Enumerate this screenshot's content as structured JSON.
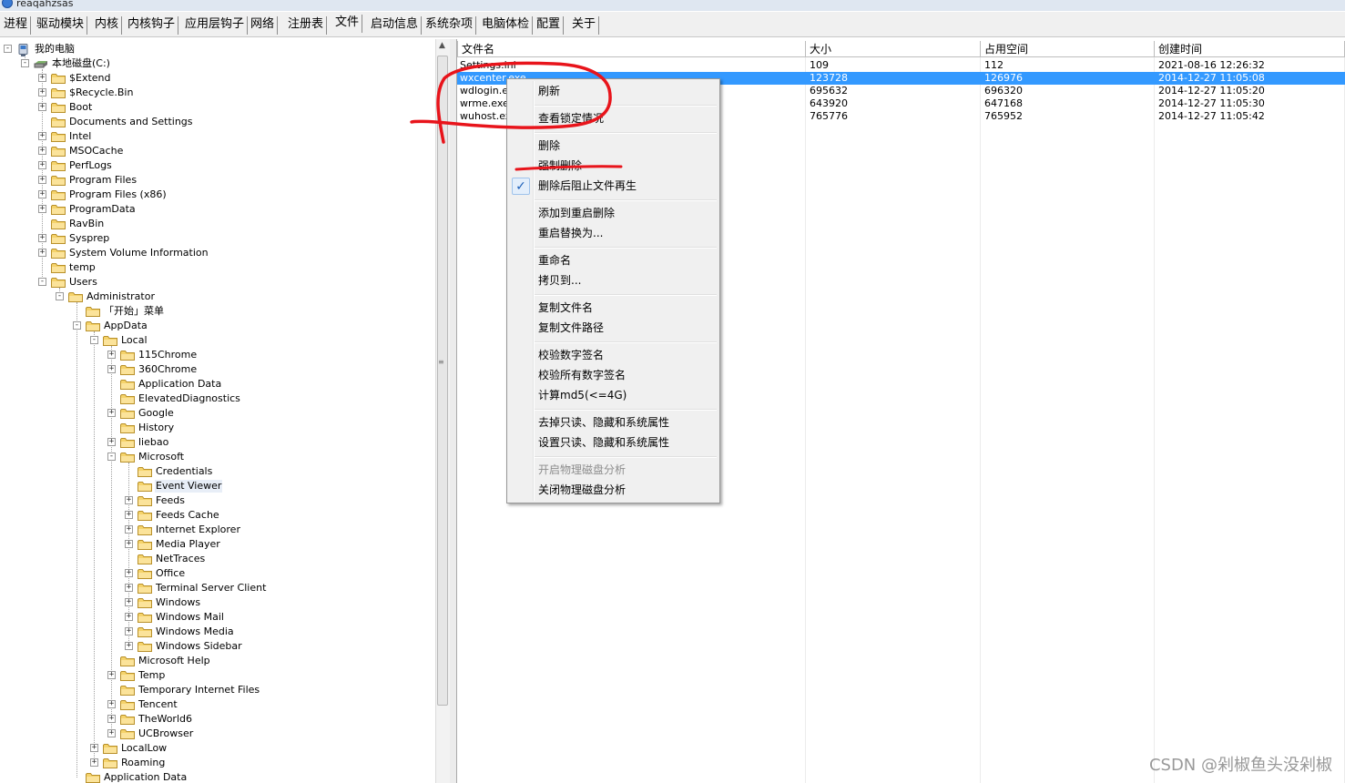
{
  "window": {
    "title": "reaqahzsas"
  },
  "tabs": [
    {
      "label": "进程",
      "active": false
    },
    {
      "label": "驱动模块",
      "active": false
    },
    {
      "label": "内核",
      "active": false
    },
    {
      "label": "内核钩子",
      "active": false
    },
    {
      "label": "应用层钩子",
      "active": false
    },
    {
      "label": "网络",
      "active": false
    },
    {
      "label": "注册表",
      "active": false
    },
    {
      "label": "文件",
      "active": true
    },
    {
      "label": "启动信息",
      "active": false
    },
    {
      "label": "系统杂项",
      "active": false
    },
    {
      "label": "电脑体检",
      "active": false
    },
    {
      "label": "配置",
      "active": false
    },
    {
      "label": "关于",
      "active": false
    }
  ],
  "tree": [
    {
      "label": "我的电脑",
      "level": 0,
      "expander": "-",
      "icon": "computer-icon"
    },
    {
      "label": "本地磁盘(C:)",
      "level": 1,
      "expander": "-",
      "icon": "drive-icon"
    },
    {
      "label": "$Extend",
      "level": 2,
      "expander": "+",
      "icon": "folder-icon"
    },
    {
      "label": "$Recycle.Bin",
      "level": 2,
      "expander": "+",
      "icon": "folder-icon"
    },
    {
      "label": "Boot",
      "level": 2,
      "expander": "+",
      "icon": "folder-icon"
    },
    {
      "label": "Documents and Settings",
      "level": 2,
      "expander": "",
      "icon": "folder-icon"
    },
    {
      "label": "Intel",
      "level": 2,
      "expander": "+",
      "icon": "folder-icon"
    },
    {
      "label": "MSOCache",
      "level": 2,
      "expander": "+",
      "icon": "folder-icon"
    },
    {
      "label": "PerfLogs",
      "level": 2,
      "expander": "+",
      "icon": "folder-icon"
    },
    {
      "label": "Program Files",
      "level": 2,
      "expander": "+",
      "icon": "folder-icon"
    },
    {
      "label": "Program Files (x86)",
      "level": 2,
      "expander": "+",
      "icon": "folder-icon"
    },
    {
      "label": "ProgramData",
      "level": 2,
      "expander": "+",
      "icon": "folder-icon"
    },
    {
      "label": "RavBin",
      "level": 2,
      "expander": "",
      "icon": "folder-icon"
    },
    {
      "label": "Sysprep",
      "level": 2,
      "expander": "+",
      "icon": "folder-icon"
    },
    {
      "label": "System Volume Information",
      "level": 2,
      "expander": "+",
      "icon": "folder-icon"
    },
    {
      "label": "temp",
      "level": 2,
      "expander": "",
      "icon": "folder-icon"
    },
    {
      "label": "Users",
      "level": 2,
      "expander": "-",
      "icon": "folder-icon"
    },
    {
      "label": "Administrator",
      "level": 3,
      "expander": "-",
      "icon": "folder-icon"
    },
    {
      "label": "「开始」菜单",
      "level": 4,
      "expander": "",
      "icon": "folder-icon"
    },
    {
      "label": "AppData",
      "level": 4,
      "expander": "-",
      "icon": "folder-icon"
    },
    {
      "label": "Local",
      "level": 5,
      "expander": "-",
      "icon": "folder-icon"
    },
    {
      "label": "115Chrome",
      "level": 6,
      "expander": "+",
      "icon": "folder-icon"
    },
    {
      "label": "360Chrome",
      "level": 6,
      "expander": "+",
      "icon": "folder-icon"
    },
    {
      "label": "Application Data",
      "level": 6,
      "expander": "",
      "icon": "folder-icon"
    },
    {
      "label": "ElevatedDiagnostics",
      "level": 6,
      "expander": "",
      "icon": "folder-icon"
    },
    {
      "label": "Google",
      "level": 6,
      "expander": "+",
      "icon": "folder-icon"
    },
    {
      "label": "History",
      "level": 6,
      "expander": "",
      "icon": "folder-icon"
    },
    {
      "label": "liebao",
      "level": 6,
      "expander": "+",
      "icon": "folder-icon"
    },
    {
      "label": "Microsoft",
      "level": 6,
      "expander": "-",
      "icon": "folder-icon"
    },
    {
      "label": "Credentials",
      "level": 7,
      "expander": "",
      "icon": "folder-icon"
    },
    {
      "label": "Event Viewer",
      "level": 7,
      "expander": "",
      "icon": "folder-icon",
      "highlight": true
    },
    {
      "label": "Feeds",
      "level": 7,
      "expander": "+",
      "icon": "folder-icon"
    },
    {
      "label": "Feeds Cache",
      "level": 7,
      "expander": "+",
      "icon": "folder-icon"
    },
    {
      "label": "Internet Explorer",
      "level": 7,
      "expander": "+",
      "icon": "folder-icon"
    },
    {
      "label": "Media Player",
      "level": 7,
      "expander": "+",
      "icon": "folder-icon"
    },
    {
      "label": "NetTraces",
      "level": 7,
      "expander": "",
      "icon": "folder-icon"
    },
    {
      "label": "Office",
      "level": 7,
      "expander": "+",
      "icon": "folder-icon"
    },
    {
      "label": "Terminal Server Client",
      "level": 7,
      "expander": "+",
      "icon": "folder-icon"
    },
    {
      "label": "Windows",
      "level": 7,
      "expander": "+",
      "icon": "folder-icon"
    },
    {
      "label": "Windows Mail",
      "level": 7,
      "expander": "+",
      "icon": "folder-icon"
    },
    {
      "label": "Windows Media",
      "level": 7,
      "expander": "+",
      "icon": "folder-icon"
    },
    {
      "label": "Windows Sidebar",
      "level": 7,
      "expander": "+",
      "icon": "folder-icon"
    },
    {
      "label": "Microsoft Help",
      "level": 6,
      "expander": "",
      "icon": "folder-icon"
    },
    {
      "label": "Temp",
      "level": 6,
      "expander": "+",
      "icon": "folder-icon"
    },
    {
      "label": "Temporary Internet Files",
      "level": 6,
      "expander": "",
      "icon": "folder-icon"
    },
    {
      "label": "Tencent",
      "level": 6,
      "expander": "+",
      "icon": "folder-icon"
    },
    {
      "label": "TheWorld6",
      "level": 6,
      "expander": "+",
      "icon": "folder-icon"
    },
    {
      "label": "UCBrowser",
      "level": 6,
      "expander": "+",
      "icon": "folder-icon"
    },
    {
      "label": "LocalLow",
      "level": 5,
      "expander": "+",
      "icon": "folder-icon"
    },
    {
      "label": "Roaming",
      "level": 5,
      "expander": "+",
      "icon": "folder-icon"
    },
    {
      "label": "Application Data",
      "level": 4,
      "expander": "",
      "icon": "folder-icon"
    }
  ],
  "list": {
    "columns": [
      "文件名",
      "大小",
      "占用空间",
      "创建时间"
    ],
    "rows": [
      {
        "name": "Settings.ini",
        "size": "109",
        "space": "112",
        "created": "2021-08-16 12:26:32",
        "selected": false
      },
      {
        "name": "wxcenter.exe",
        "size": "123728",
        "space": "126976",
        "created": "2014-12-27 11:05:08",
        "selected": true
      },
      {
        "name": "wdlogin.exe",
        "size": "695632",
        "space": "696320",
        "created": "2014-12-27 11:05:20",
        "selected": false
      },
      {
        "name": "wrme.exe",
        "size": "643920",
        "space": "647168",
        "created": "2014-12-27 11:05:30",
        "selected": false
      },
      {
        "name": "wuhost.exe",
        "size": "765776",
        "space": "765952",
        "created": "2014-12-27 11:05:42",
        "selected": false
      }
    ]
  },
  "context_menu": {
    "items": [
      {
        "label": "刷新",
        "name": "menu-refresh",
        "separator_after": true
      },
      {
        "label": "查看锁定情况",
        "name": "menu-view-lock",
        "separator_after": true
      },
      {
        "label": "删除",
        "name": "menu-delete"
      },
      {
        "label": "强制删除",
        "name": "menu-force-delete"
      },
      {
        "label": "删除后阻止文件再生",
        "name": "menu-block-regenerate",
        "checked": true,
        "separator_after": true
      },
      {
        "label": "添加到重启删除",
        "name": "menu-delete-on-reboot"
      },
      {
        "label": "重启替换为...",
        "name": "menu-replace-on-reboot",
        "separator_after": true
      },
      {
        "label": "重命名",
        "name": "menu-rename"
      },
      {
        "label": "拷贝到...",
        "name": "menu-copy-to",
        "separator_after": true
      },
      {
        "label": "复制文件名",
        "name": "menu-copy-filename"
      },
      {
        "label": "复制文件路径",
        "name": "menu-copy-filepath",
        "separator_after": true
      },
      {
        "label": "校验数字签名",
        "name": "menu-verify-signature"
      },
      {
        "label": "校验所有数字签名",
        "name": "menu-verify-all-signatures"
      },
      {
        "label": "计算md5(<=4G)",
        "name": "menu-md5",
        "separator_after": true
      },
      {
        "label": "去掉只读、隐藏和系统属性",
        "name": "menu-remove-attributes"
      },
      {
        "label": "设置只读、隐藏和系统属性",
        "name": "menu-set-attributes",
        "separator_after": true
      },
      {
        "label": "开启物理磁盘分析",
        "name": "menu-enable-disk-analysis",
        "disabled": true
      },
      {
        "label": "关闭物理磁盘分析",
        "name": "menu-disable-disk-analysis"
      }
    ]
  },
  "colors": {
    "selection": "#3399ff",
    "annotation": "#e8141b",
    "folder": "#f5d36b"
  },
  "watermark": "CSDN @剁椒鱼头没剁椒"
}
